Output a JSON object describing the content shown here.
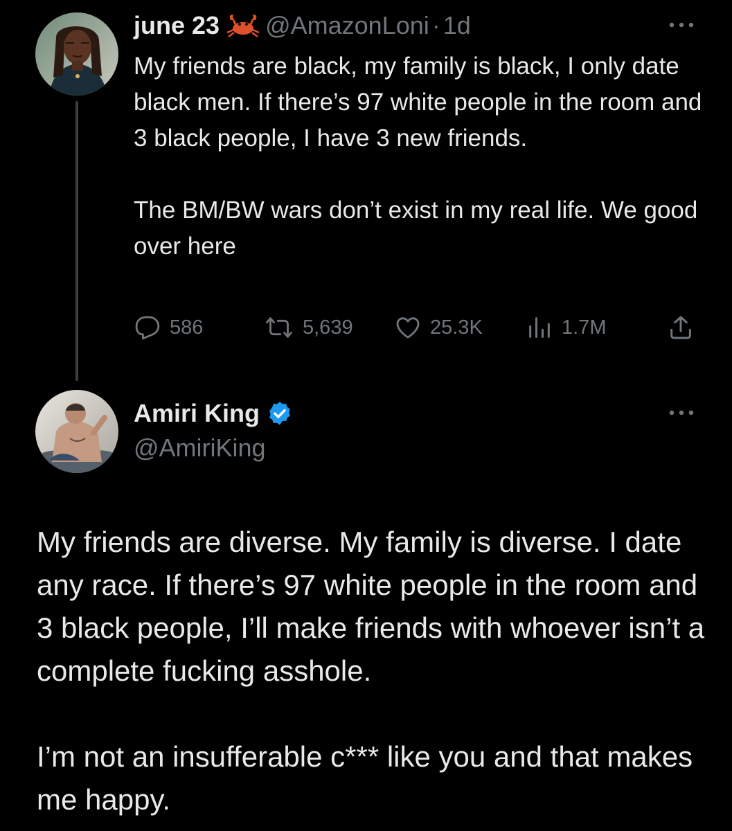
{
  "colors": {
    "background": "#000000",
    "text": "#e7e9ea",
    "secondary_text": "#71767b",
    "thread_line": "#3a3f44",
    "verified_blue": "#1d9bf0"
  },
  "tweet_1": {
    "display_name": "june 23",
    "name_emoji": "crab-icon",
    "handle": "@AmazonLoni",
    "separator": "·",
    "time": "1d",
    "text_paragraphs": [
      "My friends are black, my family is black, I only date black men. If there’s 97 white people in the room and 3 black people, I have 3 new friends.",
      "The BM/BW wars don’t exist in my real life. We good over here"
    ],
    "metrics": {
      "replies": "586",
      "retweets": "5,639",
      "likes": "25.3K",
      "views": "1.7M"
    }
  },
  "tweet_2": {
    "display_name": "Amiri King",
    "verified": true,
    "handle": "@AmiriKing",
    "text_paragraphs": [
      "My friends are diverse. My family is diverse. I date any race. If there’s 97 white people in the room and 3 black people, I’ll make friends with whoever isn’t a complete fucking asshole.",
      "I’m not an insufferable c*** like you and that makes me happy."
    ]
  }
}
